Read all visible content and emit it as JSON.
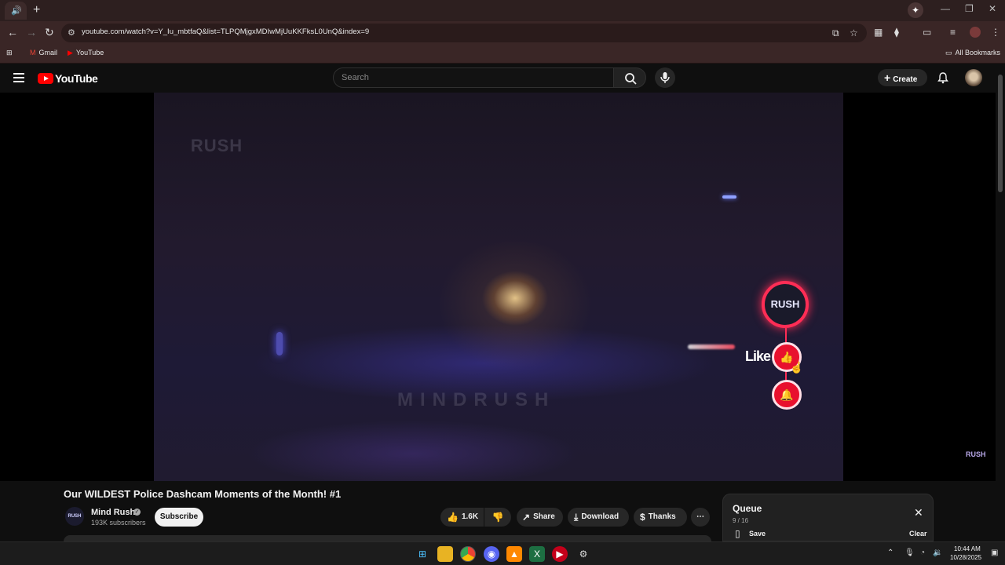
{
  "browser": {
    "url": "youtube.com/watch?v=Y_Iu_mbtfaQ&list=TLPQMjgxMDIwMjUuKKFksL0UnQ&index=9",
    "bookmarks": [
      {
        "label": "Gmail",
        "icon": "gmail-icon"
      },
      {
        "label": "YouTube",
        "icon": "youtube-icon"
      }
    ],
    "all_bookmarks": "All Bookmarks"
  },
  "youtube": {
    "logo": "YouTube",
    "search_placeholder": "Search",
    "create_label": "Create"
  },
  "video": {
    "watermark_top": "RUSH",
    "watermark_mid": "MINDRUSH",
    "overlay_logo": "RUSH",
    "overlay_like_text": "Like",
    "corner_watermark": "RUSH"
  },
  "video_info": {
    "title": "Our WILDEST Police Dashcam Moments of the Month! #1",
    "channel_name": "Mind Rush",
    "channel_avatar_text": "RUSH",
    "subscribers": "193K subscribers",
    "subscribe_label": "Subscribe",
    "likes": "1.6K",
    "share_label": "Share",
    "download_label": "Download",
    "thanks_label": "Thanks"
  },
  "queue": {
    "title": "Queue",
    "count": "9 / 16",
    "save_label": "Save",
    "clear_label": "Clear"
  },
  "taskbar": {
    "time": "10:44 AM",
    "date": "10/28/2025",
    "apps": [
      "start-icon",
      "file-explorer-icon",
      "chrome-icon",
      "discord-icon",
      "vlc-icon",
      "excel-icon",
      "youtube-music-icon",
      "settings-icon"
    ]
  },
  "colors": {
    "accent_red": "#ff0000",
    "overlay_pink": "#ff2d55",
    "background": "#0f0f0f"
  }
}
